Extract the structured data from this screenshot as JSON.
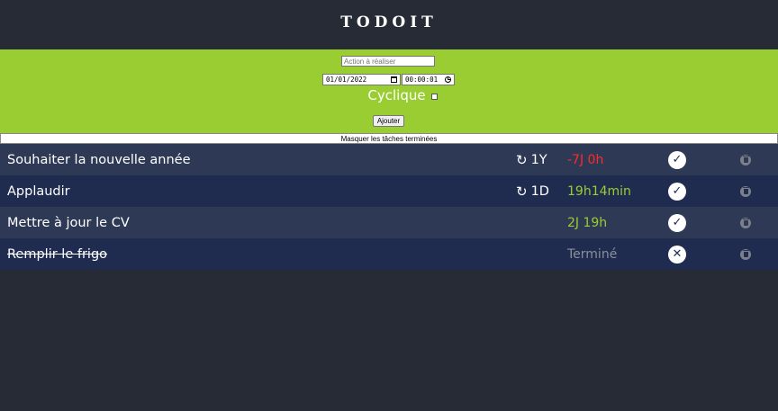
{
  "app": {
    "title": "TODOIT"
  },
  "form": {
    "action_placeholder": "Action à réaliser",
    "date_value": "01/01/2022",
    "time_value": "00:00:01",
    "cyclique_label": "Cyclique",
    "cyclique_checked": false,
    "add_label": "Ajouter"
  },
  "filter": {
    "hide_done_label": "Masquer les tâches terminées"
  },
  "colors": {
    "accent_green": "#9acd32",
    "overdue_red": "#ff2a2a",
    "remaining_green": "#9acd32",
    "done_gray": "#8a8f99"
  },
  "tasks": [
    {
      "name": "Souhaiter la nouvelle année",
      "cycle_icon": "repeat-icon",
      "cycle": "1Y",
      "remaining": "-7J 0h",
      "status": "overdue",
      "action_icon": "check-icon",
      "action_glyph": "✓",
      "done": false
    },
    {
      "name": "Applaudir",
      "cycle_icon": "repeat-icon",
      "cycle": "1D",
      "remaining": "19h14min",
      "status": "pending",
      "action_icon": "check-icon",
      "action_glyph": "✓",
      "done": false
    },
    {
      "name": "Mettre à jour le CV",
      "cycle_icon": "",
      "cycle": "",
      "remaining": "2J 19h",
      "status": "pending",
      "action_icon": "check-icon",
      "action_glyph": "✓",
      "done": false
    },
    {
      "name": "Remplir le frigo",
      "cycle_icon": "",
      "cycle": "",
      "remaining": "Terminé",
      "status": "done",
      "action_icon": "close-icon",
      "action_glyph": "✕",
      "done": true
    }
  ]
}
